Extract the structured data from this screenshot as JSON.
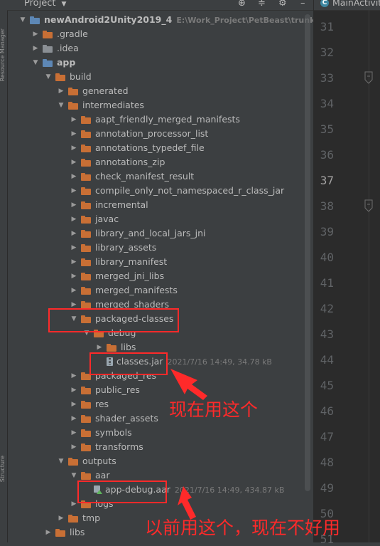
{
  "header": {
    "title": "Project",
    "dropdown": "▼",
    "icons": [
      "crosshair-icon",
      "collapse-icon",
      "settings-icon"
    ]
  },
  "toolstrip": {
    "labels": [
      "Resource Manager",
      "Structure"
    ]
  },
  "tree": [
    {
      "level": 0,
      "open": true,
      "icon": "blue",
      "label": "newAndroid2Unity2019_4",
      "bold": true,
      "meta": "E:\\Work_Project\\PetBeast\\trunk_beast\\n"
    },
    {
      "level": 1,
      "open": false,
      "icon": "orange",
      "label": ".gradle"
    },
    {
      "level": 1,
      "open": false,
      "icon": "grey",
      "label": ".idea"
    },
    {
      "level": 1,
      "open": true,
      "icon": "blue",
      "label": "app",
      "bold": true
    },
    {
      "level": 2,
      "open": true,
      "icon": "orange",
      "label": "build"
    },
    {
      "level": 3,
      "open": false,
      "icon": "orange",
      "label": "generated"
    },
    {
      "level": 3,
      "open": true,
      "icon": "orange",
      "label": "intermediates"
    },
    {
      "level": 4,
      "open": false,
      "icon": "orange",
      "label": "aapt_friendly_merged_manifests"
    },
    {
      "level": 4,
      "open": false,
      "icon": "orange",
      "label": "annotation_processor_list"
    },
    {
      "level": 4,
      "open": false,
      "icon": "orange",
      "label": "annotations_typedef_file"
    },
    {
      "level": 4,
      "open": false,
      "icon": "orange",
      "label": "annotations_zip"
    },
    {
      "level": 4,
      "open": false,
      "icon": "orange",
      "label": "check_manifest_result"
    },
    {
      "level": 4,
      "open": false,
      "icon": "orange",
      "label": "compile_only_not_namespaced_r_class_jar"
    },
    {
      "level": 4,
      "open": false,
      "icon": "orange",
      "label": "incremental"
    },
    {
      "level": 4,
      "open": false,
      "icon": "orange",
      "label": "javac"
    },
    {
      "level": 4,
      "open": false,
      "icon": "orange",
      "label": "library_and_local_jars_jni"
    },
    {
      "level": 4,
      "open": false,
      "icon": "orange",
      "label": "library_assets"
    },
    {
      "level": 4,
      "open": false,
      "icon": "orange",
      "label": "library_manifest"
    },
    {
      "level": 4,
      "open": false,
      "icon": "orange",
      "label": "merged_jni_libs"
    },
    {
      "level": 4,
      "open": false,
      "icon": "orange",
      "label": "merged_manifests"
    },
    {
      "level": 4,
      "open": false,
      "icon": "orange",
      "label": "merged_shaders"
    },
    {
      "level": 4,
      "open": true,
      "icon": "orange",
      "label": "packaged-classes"
    },
    {
      "level": 5,
      "open": true,
      "icon": "orange",
      "label": "debug"
    },
    {
      "level": 6,
      "open": false,
      "icon": "orange",
      "label": "libs"
    },
    {
      "level": 6,
      "leaf": true,
      "icon": "jar",
      "label": "classes.jar",
      "meta": "2021/7/16 14:49, 34.78 kB"
    },
    {
      "level": 4,
      "open": false,
      "icon": "orange",
      "label": "packaged_res"
    },
    {
      "level": 4,
      "open": false,
      "icon": "orange",
      "label": "public_res"
    },
    {
      "level": 4,
      "open": false,
      "icon": "orange",
      "label": "res"
    },
    {
      "level": 4,
      "open": false,
      "icon": "orange",
      "label": "shader_assets"
    },
    {
      "level": 4,
      "open": false,
      "icon": "orange",
      "label": "symbols"
    },
    {
      "level": 4,
      "open": false,
      "icon": "orange",
      "label": "transforms"
    },
    {
      "level": 3,
      "open": true,
      "icon": "orange",
      "label": "outputs"
    },
    {
      "level": 4,
      "open": true,
      "icon": "orange",
      "label": "aar"
    },
    {
      "level": 5,
      "leaf": true,
      "icon": "aar",
      "label": "app-debug.aar",
      "meta": "2021/7/16 14:49, 434.87 kB"
    },
    {
      "level": 4,
      "open": false,
      "icon": "orange",
      "label": "logs"
    },
    {
      "level": 3,
      "open": false,
      "icon": "orange",
      "label": "tmp"
    },
    {
      "level": 2,
      "open": false,
      "icon": "orange",
      "label": "libs"
    }
  ],
  "editor": {
    "tab_label": "MainActivity",
    "tab_icon": "C",
    "line_numbers": [
      "31",
      "32",
      "33",
      "34",
      "35",
      "36",
      "37",
      "38",
      "39",
      "40",
      "41",
      "42",
      "43",
      "44",
      "45",
      "46",
      "47",
      "48",
      "49",
      "50",
      "51"
    ],
    "current_line": "37"
  },
  "annotations": {
    "now_use": "现在用这个",
    "before_use": "以前用这个，现在不好用"
  },
  "colors": {
    "annotation": "#ff2a2a",
    "folder": "#c86f35",
    "background": "#3c3f41"
  }
}
